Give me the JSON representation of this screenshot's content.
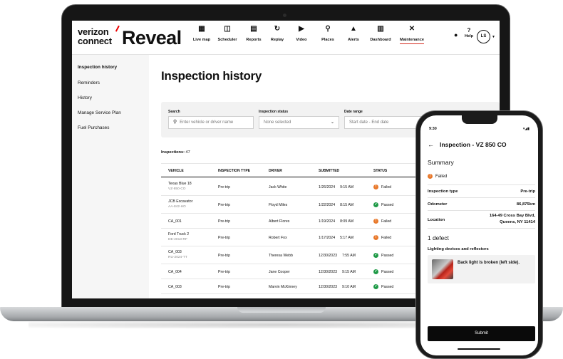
{
  "header": {
    "brand_top": "verizon",
    "brand_bottom": "connect",
    "brand_product": "Reveal",
    "nav": [
      {
        "label": "Live map",
        "icon": "map-icon"
      },
      {
        "label": "Scheduler",
        "icon": "calendar-icon"
      },
      {
        "label": "Reports",
        "icon": "report-icon"
      },
      {
        "label": "Replay",
        "icon": "replay-icon"
      },
      {
        "label": "Video",
        "icon": "video-icon"
      },
      {
        "label": "Places",
        "icon": "places-icon"
      },
      {
        "label": "Alerts",
        "icon": "alert-icon"
      },
      {
        "label": "Dashboard",
        "icon": "dashboard-icon"
      },
      {
        "label": "Maintenance",
        "icon": "wrench-icon",
        "active": true
      }
    ],
    "help_label": "Help",
    "avatar_initials": "LS"
  },
  "sidebar": {
    "items": [
      {
        "label": "Inspection history",
        "active": true
      },
      {
        "label": "Reminders"
      },
      {
        "label": "History"
      },
      {
        "label": "Manage Service Plan"
      },
      {
        "label": "Fuel Purchases"
      }
    ]
  },
  "main": {
    "title": "Inspection history",
    "filters": {
      "search_label": "Search",
      "search_placeholder": "Enter vehicle or driver name",
      "status_label": "Inspection status",
      "status_value": "None selected",
      "date_label": "Date range",
      "date_placeholder": "Start date - End date"
    },
    "count_label": "Inspections:",
    "count_value": "47",
    "columns": [
      "VEHICLE",
      "INSPECTION TYPE",
      "DRIVER",
      "SUBMITTED",
      "STATUS"
    ],
    "rows": [
      {
        "vehicle": "Texas Blue 18",
        "plate": "VZ-850-CO",
        "type": "Pre-trip",
        "driver": "Jack White",
        "date": "1/26/2024",
        "time": "9:15 AM",
        "status": "Failed"
      },
      {
        "vehicle": "JCB Excavator",
        "plate": "AA-842-HO",
        "type": "Pre-trip",
        "driver": "Floyd Miles",
        "date": "1/22/2024",
        "time": "8:15 AM",
        "status": "Passed"
      },
      {
        "vehicle": "CA_001",
        "plate": "",
        "type": "Pre-trip",
        "driver": "Albert Flores",
        "date": "1/19/2024",
        "time": "8:09 AM",
        "status": "Failed"
      },
      {
        "vehicle": "Ford Truck 2",
        "plate": "DE-2013-RF",
        "type": "Pre-trip",
        "driver": "Robert Fox",
        "date": "1/17/2024",
        "time": "5:17 AM",
        "status": "Failed"
      },
      {
        "vehicle": "CA_003",
        "plate": "RU-2024-TT",
        "type": "Pre-trip",
        "driver": "Theresa Webb",
        "date": "12/30/2023",
        "time": "7:55 AM",
        "status": "Passed"
      },
      {
        "vehicle": "CA_004",
        "plate": "",
        "type": "Pre-trip",
        "driver": "Jane Cooper",
        "date": "12/30/2023",
        "time": "9:15 AM",
        "status": "Passed"
      },
      {
        "vehicle": "CA_003",
        "plate": "",
        "type": "Pre-trip",
        "driver": "Marvin McKinney",
        "date": "12/30/2023",
        "time": "9:10 AM",
        "status": "Passed"
      }
    ]
  },
  "phone": {
    "time": "9:30",
    "title": "Inspection - VZ 850 CO",
    "summary_heading": "Summary",
    "status": "Failed",
    "details": [
      {
        "label": "Inspection type",
        "value": "Pre-trip"
      },
      {
        "label": "Odometer",
        "value": "86,875km"
      },
      {
        "label": "Location",
        "value": "164-49 Cross Bay Blvd,",
        "value2": "Queens, NY 11414"
      }
    ],
    "defect_heading": "1 defect",
    "defect_category": "Lighting devices and reflectors",
    "defect_text": "Back light is broken (left side).",
    "submit_label": "Submit"
  },
  "colors": {
    "failed": "#e8782a",
    "passed": "#1f9a47",
    "accent": "#d52b1e"
  }
}
